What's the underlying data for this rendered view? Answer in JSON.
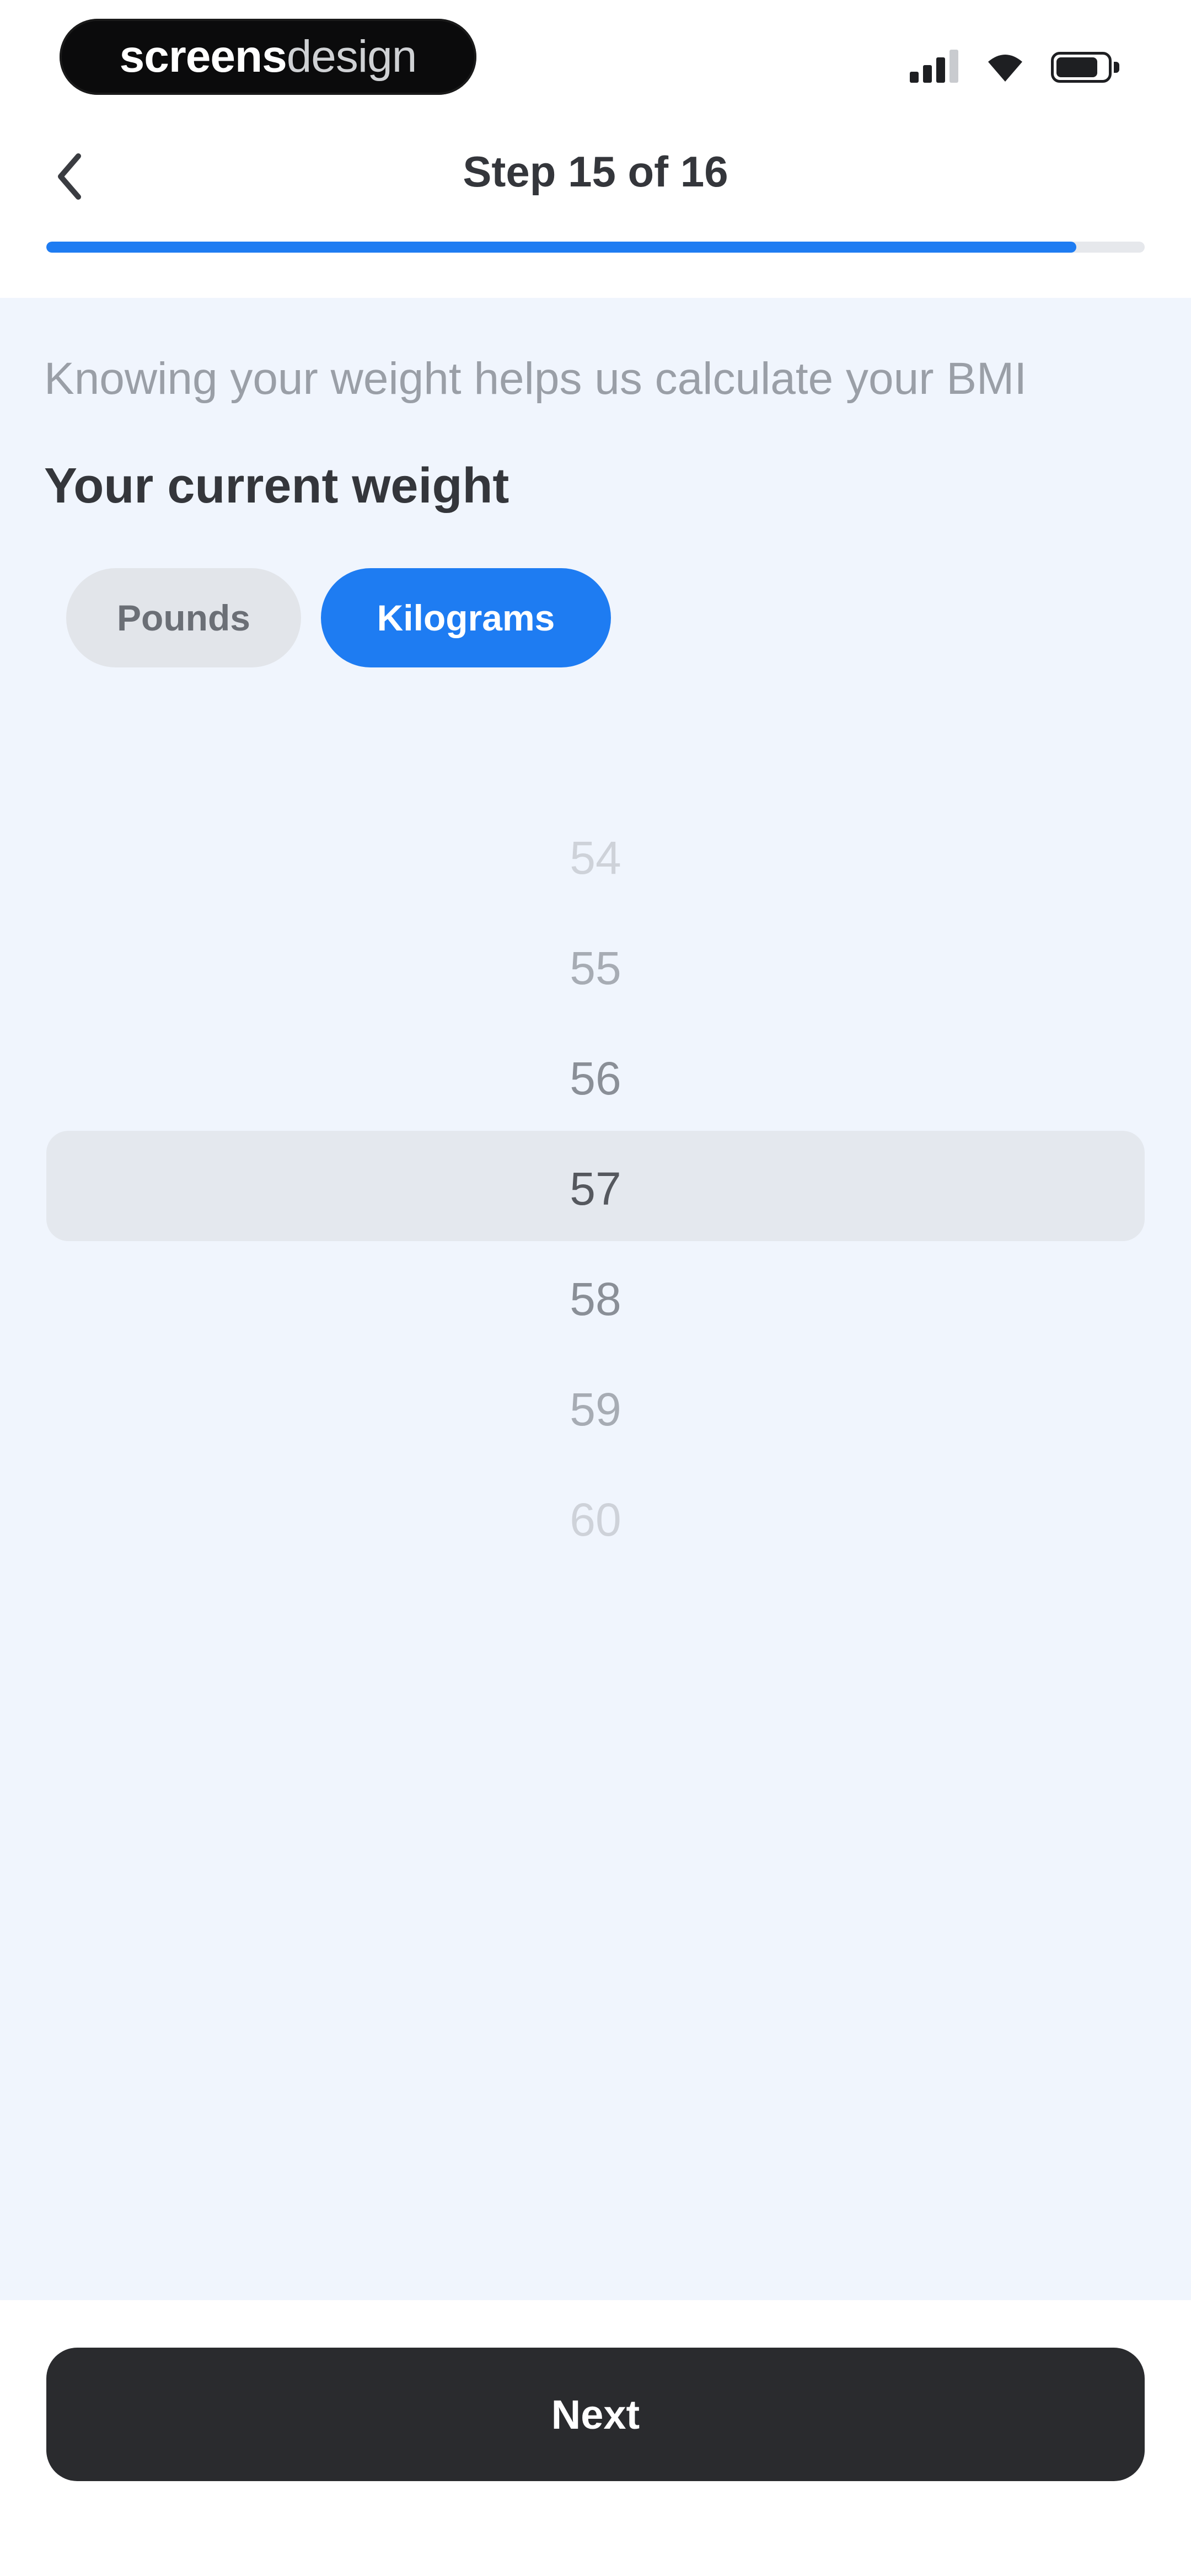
{
  "status_bar": {
    "brand_bold": "screens",
    "brand_light": "design",
    "icons": [
      "cellular-signal-icon",
      "wifi-icon",
      "battery-icon"
    ]
  },
  "header": {
    "back_icon": "chevron-left-icon",
    "step_title": "Step 15 of 16",
    "progress": {
      "current": 15,
      "total": 16
    },
    "accent_color": "#1e7cf2"
  },
  "main": {
    "subtitle": "Knowing your weight helps us calculate your BMI",
    "question": "Your current weight",
    "unit_options": [
      {
        "label": "Pounds",
        "selected": false
      },
      {
        "label": "Kilograms",
        "selected": true
      }
    ],
    "picker": {
      "values": [
        "54",
        "55",
        "56",
        "57",
        "58",
        "59",
        "60"
      ],
      "selected": "57"
    }
  },
  "footer": {
    "next_label": "Next"
  }
}
